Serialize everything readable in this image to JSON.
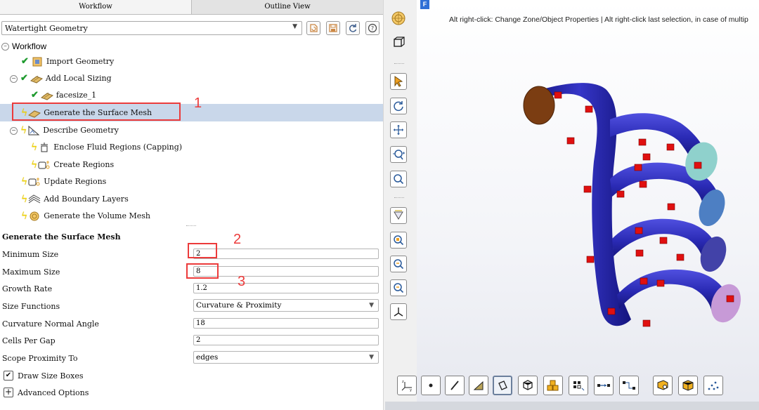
{
  "tabs": [
    {
      "label": "Workflow"
    },
    {
      "label": "Outline View"
    }
  ],
  "workflow_selector": {
    "value": "Watertight Geometry"
  },
  "tree": {
    "root_label": "Workflow",
    "items": [
      {
        "label": "Import Geometry",
        "status": "done"
      },
      {
        "label": "Add Local Sizing",
        "status": "done"
      },
      {
        "label": "facesize_1",
        "status": "done"
      },
      {
        "label": "Generate the Surface Mesh",
        "status": "pending",
        "selected": true
      },
      {
        "label": "Describe Geometry",
        "status": "pending"
      },
      {
        "label": "Enclose Fluid Regions (Capping)",
        "status": "pending"
      },
      {
        "label": "Create Regions",
        "status": "pending"
      },
      {
        "label": "Update Regions",
        "status": "pending"
      },
      {
        "label": "Add Boundary Layers",
        "status": "pending"
      },
      {
        "label": "Generate the Volume Mesh",
        "status": "pending"
      }
    ]
  },
  "properties": {
    "title": "Generate the Surface Mesh",
    "fields": [
      {
        "label": "Minimum Size",
        "value": "2"
      },
      {
        "label": "Maximum Size",
        "value": "8"
      },
      {
        "label": "Growth Rate",
        "value": "1.2"
      },
      {
        "label": "Size Functions",
        "value": "Curvature & Proximity"
      },
      {
        "label": "Curvature Normal Angle",
        "value": "18"
      },
      {
        "label": "Cells Per Gap",
        "value": "2"
      },
      {
        "label": "Scope Proximity To",
        "value": "edges"
      }
    ],
    "draw_size_boxes": {
      "label": "Draw Size Boxes",
      "checked": true
    },
    "advanced_options": {
      "label": "Advanced Options"
    }
  },
  "annotations": [
    "1",
    "2",
    "3"
  ],
  "viewport": {
    "hint": "Alt right-click: Change Zone/Object Properties | Alt right-click last selection, in case of multip",
    "app_badge": "F"
  },
  "colors": {
    "selection_row": "#c9d7ea",
    "annotation_red": "#ec3b3b",
    "mesh_body": "#2c2ca8",
    "size_box": "#e01010"
  }
}
